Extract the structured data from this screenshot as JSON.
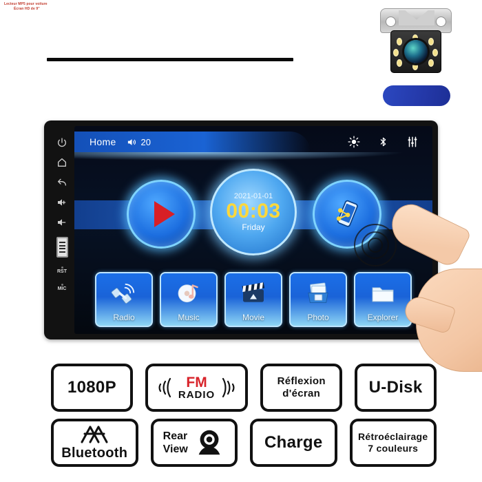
{
  "headline": {
    "line1": "Lecteur MP5 pour voiture",
    "line2": "Écran HD de 9\""
  },
  "device": {
    "side_buttons": [
      {
        "name": "power",
        "label": "power-icon"
      },
      {
        "name": "home",
        "label": "home-icon"
      },
      {
        "name": "back",
        "label": "back-icon"
      },
      {
        "name": "volume-up",
        "label": "volume-up-icon"
      },
      {
        "name": "volume-down",
        "label": "volume-down-icon"
      },
      {
        "name": "usb-port",
        "label": "usb-icon"
      }
    ],
    "reset_label": "RST",
    "mic_label": "MIC"
  },
  "screen": {
    "statusbar": {
      "home": "Home",
      "volume": "20",
      "icons": [
        "brightness-icon",
        "bluetooth-icon",
        "equalizer-icon"
      ]
    },
    "clock": {
      "date": "2021-01-01",
      "time": "00:03",
      "day": "Friday"
    },
    "shortcuts": [
      {
        "name": "play",
        "icon": "play-icon"
      },
      {
        "name": "screen-mirror",
        "icon": "phone-link-icon"
      }
    ],
    "tiles": [
      {
        "label": "Radio",
        "icon": "satellite-icon"
      },
      {
        "label": "Music",
        "icon": "cd-note-icon"
      },
      {
        "label": "Movie",
        "icon": "clapperboard-icon"
      },
      {
        "label": "Photo",
        "icon": "photo-box-icon"
      },
      {
        "label": "Explorer",
        "icon": "folder-icon"
      }
    ],
    "colors": {
      "accent_blue": "#1a63d4",
      "glow_blue": "#7fd4ff",
      "clock_yellow": "#ffd83b",
      "play_red": "#d81f26"
    }
  },
  "badges": {
    "row1": [
      {
        "id": "resolution",
        "text": "1080P",
        "icon": null
      },
      {
        "id": "fm-radio",
        "text_top": "FM",
        "text_bottom": "RADIO",
        "icon": "radio-waves-icon"
      },
      {
        "id": "screen-mirror",
        "line1": "Réflexion",
        "line2": "d'écran",
        "icon": null
      },
      {
        "id": "u-disk",
        "text": "U-Disk",
        "icon": null
      }
    ],
    "row2": [
      {
        "id": "bluetooth",
        "text": "Bluetooth",
        "icon": "bluetooth-logo-icon"
      },
      {
        "id": "rear-view",
        "line1": "Rear",
        "line2": "View",
        "icon": "camera-icon"
      },
      {
        "id": "charge",
        "text": "Charge",
        "icon": null
      },
      {
        "id": "backlight",
        "line1": "Rétroéclairage",
        "line2": "7 couleurs",
        "icon": null
      }
    ]
  }
}
